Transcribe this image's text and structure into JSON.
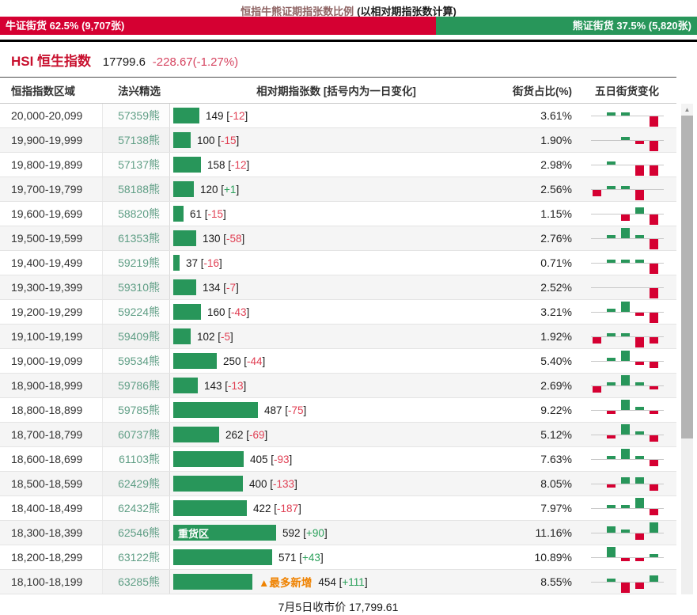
{
  "title": {
    "main": "恒指牛熊证期指张数比例",
    "note": "(以相对期指张数计算)"
  },
  "banner": {
    "bull_label": "牛证街货 62.5% (9,707张)",
    "bear_label": "熊证街货 37.5% (5,820张)",
    "bull_pct": 62.5,
    "bear_pct": 37.5
  },
  "index_info": {
    "name": "HSI 恒生指数",
    "price": "17799.6",
    "change": "-228.67(-1.27%)"
  },
  "table": {
    "headers": [
      "恒指指数区域",
      "法兴精选",
      "相对期指张数 [括号内为一日变化]",
      "街货占比(%)",
      "五日街货变化"
    ],
    "brackets": [
      "[",
      "]"
    ]
  },
  "chart_data": {
    "type": "bar",
    "title": "恒指牛熊证期指张数比例 (以相对期指张数计算)",
    "xlabel": "相对期指张数",
    "ylabel": "恒指指数区域",
    "max_bar_value": 592,
    "rows": [
      {
        "range": "20,000-20,099",
        "code": "57359熊",
        "value": 149,
        "change": "-12",
        "pct": "3.61%",
        "spark": [
          0,
          1,
          1,
          0,
          -3
        ]
      },
      {
        "range": "19,900-19,999",
        "code": "57138熊",
        "value": 100,
        "change": "-15",
        "pct": "1.90%",
        "spark": [
          0,
          0,
          1,
          -1,
          -3
        ]
      },
      {
        "range": "19,800-19,899",
        "code": "57137熊",
        "value": 158,
        "change": "-12",
        "pct": "2.98%",
        "spark": [
          0,
          1,
          0,
          -3,
          -3
        ]
      },
      {
        "range": "19,700-19,799",
        "code": "58188熊",
        "value": 120,
        "change": "+1",
        "pct": "2.56%",
        "spark": [
          -2,
          1,
          1,
          -3,
          0
        ]
      },
      {
        "range": "19,600-19,699",
        "code": "58820熊",
        "value": 61,
        "change": "-15",
        "pct": "1.15%",
        "spark": [
          0,
          0,
          -2,
          2,
          -3
        ]
      },
      {
        "range": "19,500-19,599",
        "code": "61353熊",
        "value": 130,
        "change": "-58",
        "pct": "2.76%",
        "spark": [
          0,
          1,
          3,
          1,
          -3
        ]
      },
      {
        "range": "19,400-19,499",
        "code": "59219熊",
        "value": 37,
        "change": "-16",
        "pct": "0.71%",
        "spark": [
          0,
          1,
          1,
          1,
          -3
        ]
      },
      {
        "range": "19,300-19,399",
        "code": "59310熊",
        "value": 134,
        "change": "-7",
        "pct": "2.52%",
        "spark": [
          0,
          0,
          0,
          0,
          -3
        ]
      },
      {
        "range": "19,200-19,299",
        "code": "59224熊",
        "value": 160,
        "change": "-43",
        "pct": "3.21%",
        "spark": [
          0,
          1,
          3,
          -1,
          -3
        ]
      },
      {
        "range": "19,100-19,199",
        "code": "59409熊",
        "value": 102,
        "change": "-5",
        "pct": "1.92%",
        "spark": [
          -2,
          1,
          1,
          -3,
          -2
        ]
      },
      {
        "range": "19,000-19,099",
        "code": "59534熊",
        "value": 250,
        "change": "-44",
        "pct": "5.40%",
        "spark": [
          0,
          1,
          3,
          -1,
          -2
        ]
      },
      {
        "range": "18,900-18,999",
        "code": "59786熊",
        "value": 143,
        "change": "-13",
        "pct": "2.69%",
        "spark": [
          -2,
          1,
          3,
          1,
          -1
        ]
      },
      {
        "range": "18,800-18,899",
        "code": "59785熊",
        "value": 487,
        "change": "-75",
        "pct": "9.22%",
        "spark": [
          0,
          -1,
          3,
          1,
          -1
        ]
      },
      {
        "range": "18,700-18,799",
        "code": "60737熊",
        "value": 262,
        "change": "-69",
        "pct": "5.12%",
        "spark": [
          0,
          -1,
          3,
          1,
          -2
        ]
      },
      {
        "range": "18,600-18,699",
        "code": "61103熊",
        "value": 405,
        "change": "-93",
        "pct": "7.63%",
        "spark": [
          0,
          1,
          3,
          1,
          -2
        ]
      },
      {
        "range": "18,500-18,599",
        "code": "62429熊",
        "value": 400,
        "change": "-133",
        "pct": "8.05%",
        "spark": [
          0,
          -1,
          2,
          2,
          -2
        ]
      },
      {
        "range": "18,400-18,499",
        "code": "62432熊",
        "value": 422,
        "change": "-187",
        "pct": "7.97%",
        "spark": [
          0,
          1,
          1,
          3,
          -2
        ]
      },
      {
        "range": "18,300-18,399",
        "code": "62546熊",
        "value": 592,
        "change": "+90",
        "pct": "11.16%",
        "spark": [
          0,
          2,
          1,
          -2,
          3
        ],
        "bar_label": "重货区"
      },
      {
        "range": "18,200-18,299",
        "code": "63122熊",
        "value": 571,
        "change": "+43",
        "pct": "10.89%",
        "spark": [
          0,
          3,
          -1,
          -1,
          1
        ]
      },
      {
        "range": "18,100-18,199",
        "code": "63285熊",
        "value": 454,
        "change": "+111",
        "pct": "8.55%",
        "spark": [
          0,
          1,
          -3,
          -2,
          2
        ],
        "tag": "▲最多新增"
      }
    ]
  },
  "footer": "7月5日收市价 17,799.61",
  "scrollbar": {
    "up_arrow": "▲"
  },
  "colors": {
    "red_banner": "#d50032",
    "green": "#28965a",
    "red_text": "#e03e52",
    "green_text": "#2aa05a",
    "orange": "#ef8200"
  }
}
